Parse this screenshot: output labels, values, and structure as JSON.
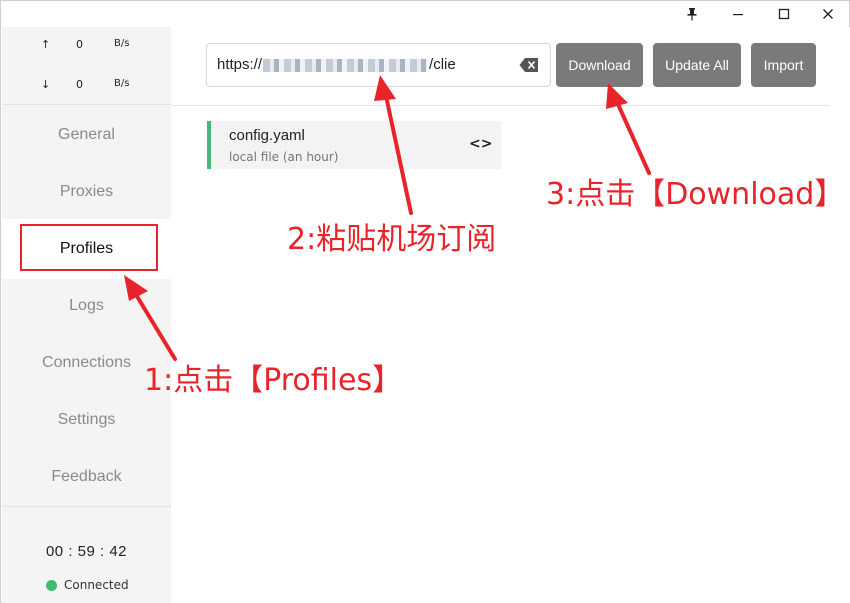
{
  "window_controls": {
    "pin_icon": "pin-icon",
    "minimize_icon": "minimize-icon",
    "maximize_icon": "maximize-icon",
    "close_icon": "close-icon"
  },
  "traffic": {
    "up_arrow": "↑",
    "up_value": "0",
    "up_unit": "B/s",
    "down_arrow": "↓",
    "down_value": "0",
    "down_unit": "B/s"
  },
  "sidebar": {
    "items": [
      {
        "label": "General"
      },
      {
        "label": "Proxies"
      },
      {
        "label": "Profiles"
      },
      {
        "label": "Logs"
      },
      {
        "label": "Connections"
      },
      {
        "label": "Settings"
      },
      {
        "label": "Feedback"
      }
    ],
    "active": "Profiles"
  },
  "footer": {
    "clock": "00 : 59 : 42",
    "status": "Connected",
    "status_color": "#3fba6f"
  },
  "toolbar": {
    "url_prefix": "https://",
    "url_suffix": "/clie",
    "download_label": "Download",
    "update_all_label": "Update All",
    "import_label": "Import"
  },
  "profiles": [
    {
      "name": "config.yaml",
      "subtitle": "local file (an hour)"
    }
  ],
  "annotations": {
    "step1": "1:点击【Profiles】",
    "step2": "2:粘贴机场订阅",
    "step3": "3:点击【Download】",
    "color": "#e8232a"
  }
}
